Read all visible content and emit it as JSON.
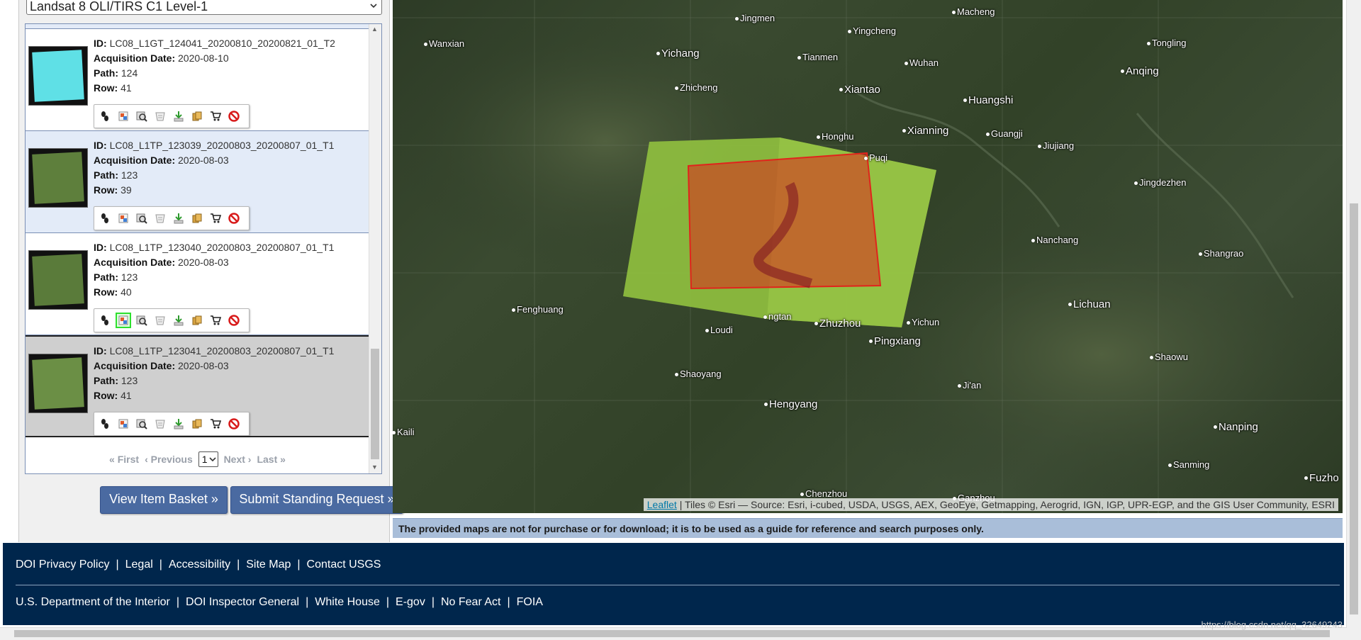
{
  "dataset": {
    "selected": "Landsat 8 OLI/TIRS C1 Level-1"
  },
  "results": [
    {
      "id_label": "ID:",
      "id": "LC08_L1GT_124041_20200810_20200821_01_T2",
      "date_label": "Acquisition Date:",
      "date": "2020-08-10",
      "path_label": "Path:",
      "path": "124",
      "row_label": "Row:",
      "row": "41",
      "thumb_color": "#5fe0e6"
    },
    {
      "id_label": "ID:",
      "id": "LC08_L1TP_123039_20200803_20200807_01_T1",
      "date_label": "Acquisition Date:",
      "date": "2020-08-03",
      "path_label": "Path:",
      "path": "123",
      "row_label": "Row:",
      "row": "39",
      "thumb_color": "#5e7f3c"
    },
    {
      "id_label": "ID:",
      "id": "LC08_L1TP_123040_20200803_20200807_01_T1",
      "date_label": "Acquisition Date:",
      "date": "2020-08-03",
      "path_label": "Path:",
      "path": "123",
      "row_label": "Row:",
      "row": "40",
      "thumb_color": "#5a7b3a"
    },
    {
      "id_label": "ID:",
      "id": "LC08_L1TP_123041_20200803_20200807_01_T1",
      "date_label": "Acquisition Date:",
      "date": "2020-08-03",
      "path_label": "Path:",
      "path": "123",
      "row_label": "Row:",
      "row": "41",
      "thumb_color": "#6b8f45"
    }
  ],
  "toolbar_icons": [
    "footprint-icon",
    "browse-overlay-icon",
    "compare-browse-icon",
    "metadata-icon",
    "download-icon",
    "bulk-download-icon",
    "order-cart-icon",
    "exclude-icon"
  ],
  "pager": {
    "first": "« First",
    "previous": "‹ Previous",
    "page": "1",
    "next": "Next ›",
    "last": "Last »"
  },
  "buttons": {
    "view_basket": "View Item Basket »",
    "standing_request": "Submit Standing Request »"
  },
  "map": {
    "cities": [
      {
        "name": "Jingmen"
      },
      {
        "name": "Macheng"
      },
      {
        "name": "Wanxian"
      },
      {
        "name": "Yingcheng"
      },
      {
        "name": "Tongling"
      },
      {
        "name": "Yichang"
      },
      {
        "name": "Tianmen"
      },
      {
        "name": "Wuhan"
      },
      {
        "name": "Anqing"
      },
      {
        "name": "Zhicheng"
      },
      {
        "name": "Xiantao"
      },
      {
        "name": "Huangshi"
      },
      {
        "name": "Honghu"
      },
      {
        "name": "Xianning"
      },
      {
        "name": "Guangji"
      },
      {
        "name": "Jiujiang"
      },
      {
        "name": "Jingdezhen"
      },
      {
        "name": "Nanchang"
      },
      {
        "name": "Shangrao"
      },
      {
        "name": "Fenghuang"
      },
      {
        "name": "Lichuan"
      },
      {
        "name": "ngtan"
      },
      {
        "name": "Zhuzhou"
      },
      {
        "name": "Yichun"
      },
      {
        "name": "Loudi"
      },
      {
        "name": "Pingxiang"
      },
      {
        "name": "Shaowu"
      },
      {
        "name": "Shaoyang"
      },
      {
        "name": "Ji'an"
      },
      {
        "name": "Hengyang"
      },
      {
        "name": "Nanping"
      },
      {
        "name": "Kaili"
      },
      {
        "name": "Sanming"
      },
      {
        "name": "Fuzho"
      },
      {
        "name": "Chenzhou"
      },
      {
        "name": "Ganzhou"
      },
      {
        "name": "Puqi"
      }
    ],
    "attribution_link": "Leaflet",
    "attribution_text": " | Tiles © Esri — Source: Esri, i-cubed, USDA, USGS, AEX, GeoEye, Getmapping, Aerogrid, IGN, IGP, UPR-EGP, and the GIS User Community, ESRI",
    "footprint_color": "#e0241c",
    "scene_color": "#8fbf3f",
    "note": "The provided maps are not for purchase or for download; it is to be used as a guide for reference and search purposes only."
  },
  "footer": {
    "row1": [
      "DOI Privacy Policy",
      "Legal",
      "Accessibility",
      "Site Map",
      "Contact USGS"
    ],
    "row2": [
      "U.S. Department of the Interior",
      "DOI Inspector General",
      "White House",
      "E-gov",
      "No Fear Act",
      "FOIA"
    ],
    "separator": "|"
  },
  "watermark": "https://blog.csdn.net/qq_32649243"
}
